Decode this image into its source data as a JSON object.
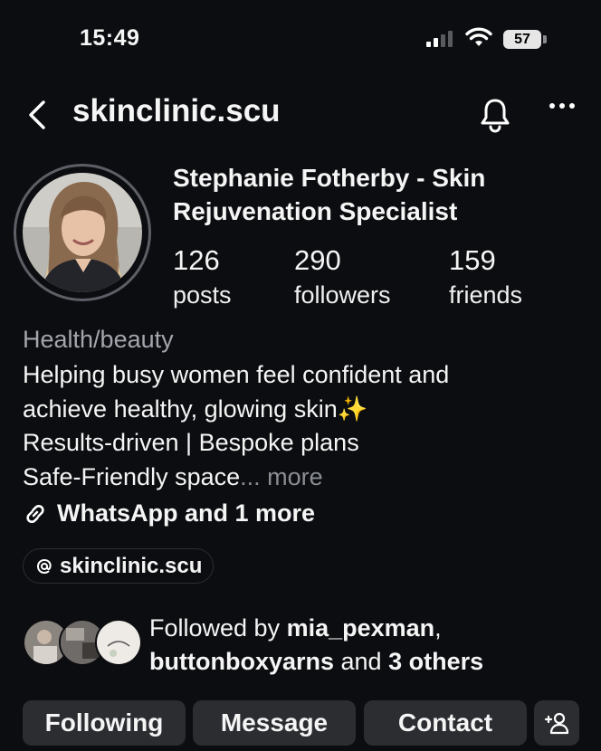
{
  "status_bar": {
    "time": "15:49",
    "battery": "57"
  },
  "header": {
    "username": "skinclinic.scu",
    "icons": [
      "back-icon",
      "bell-icon",
      "more-icon"
    ]
  },
  "profile": {
    "display_name": "Stephanie Fotherby - Skin Rejuvenation Specialist",
    "stats": [
      {
        "value": "126",
        "label": "posts"
      },
      {
        "value": "290",
        "label": "followers"
      },
      {
        "value": "159",
        "label": "friends"
      }
    ],
    "category": "Health/beauty",
    "bio_lines": [
      "Helping busy women feel confident and",
      "achieve healthy, glowing skin✨",
      "Results-driven | Bespoke plans",
      "Safe-Friendly space"
    ],
    "bio_more": "... more",
    "links_text": "WhatsApp and 1 more",
    "threads_handle": "skinclinic.scu"
  },
  "followed_by": {
    "prefix": "Followed by ",
    "user1": "mia_pexman",
    "comma": ",",
    "user2": "buttonboxyarns",
    "and": " and ",
    "others": "3 others"
  },
  "actions": {
    "following": "Following",
    "message": "Message",
    "contact": "Contact"
  },
  "colors": {
    "background": "#0c0d10",
    "button": "#2c2d31",
    "muted": "#a3a6ad"
  }
}
